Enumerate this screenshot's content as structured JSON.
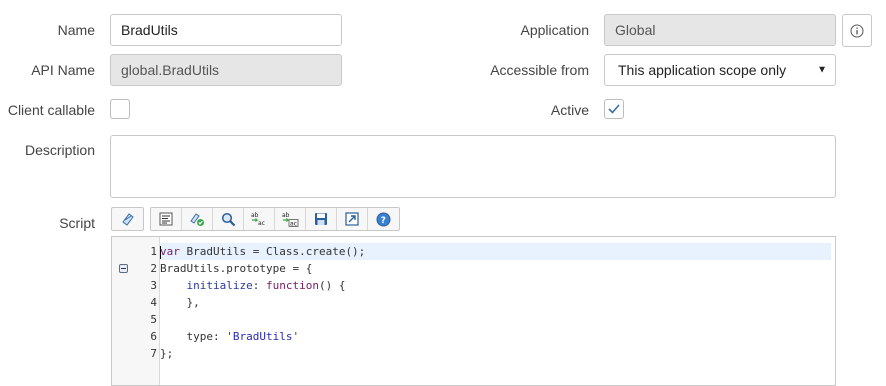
{
  "form": {
    "name_label": "Name",
    "name_value": "BradUtils",
    "api_name_label": "API Name",
    "api_name_value": "global.BradUtils",
    "client_callable_label": "Client callable",
    "client_callable_checked": false,
    "application_label": "Application",
    "application_value": "Global",
    "accessible_from_label": "Accessible from",
    "accessible_from_value": "This application scope only",
    "active_label": "Active",
    "active_checked": true,
    "description_label": "Description",
    "description_value": "",
    "script_label": "Script"
  },
  "toolbar": {
    "icons": [
      "toggle-syntax-icon",
      "format-code-icon",
      "check-script-icon",
      "search-icon",
      "replace-icon",
      "replace-all-icon",
      "save-icon",
      "fullscreen-icon",
      "help-icon"
    ]
  },
  "editor": {
    "lines": [
      {
        "num": "1",
        "text": "var BradUtils = Class.create();"
      },
      {
        "num": "2",
        "text": "BradUtils.prototype = {"
      },
      {
        "num": "3",
        "text": "    initialize: function() {"
      },
      {
        "num": "4",
        "text": "    },"
      },
      {
        "num": "5",
        "text": ""
      },
      {
        "num": "6",
        "text": "    type: 'BradUtils'"
      },
      {
        "num": "7",
        "text": "};"
      }
    ]
  }
}
